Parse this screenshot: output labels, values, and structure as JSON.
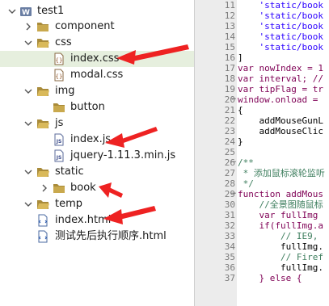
{
  "tree": {
    "root": {
      "label": "test1"
    },
    "component": {
      "label": "component"
    },
    "css": {
      "label": "css",
      "files": [
        {
          "label": "index.css"
        },
        {
          "label": "modal.css"
        }
      ]
    },
    "img": {
      "label": "img",
      "children": [
        {
          "label": "button"
        }
      ]
    },
    "js": {
      "label": "js",
      "files": [
        {
          "label": "index.js"
        },
        {
          "label": "jquery-1.11.3.min.js"
        }
      ]
    },
    "static": {
      "label": "static",
      "children": [
        {
          "label": "book"
        }
      ]
    },
    "temp": {
      "label": "temp"
    },
    "root_files": [
      {
        "label": "index.html"
      },
      {
        "label": "测试先后执行顺序.html"
      }
    ]
  },
  "editor": {
    "lines": [
      {
        "num": "11",
        "text": "    'static/book"
      },
      {
        "num": "12",
        "text": "    'static/book"
      },
      {
        "num": "13",
        "text": "    'static/book"
      },
      {
        "num": "14",
        "text": "    'static/book"
      },
      {
        "num": "15",
        "text": "    'static/book"
      },
      {
        "num": "16",
        "text": "]"
      },
      {
        "num": "17",
        "text": "var nowIndex = 1"
      },
      {
        "num": "18",
        "text": "var interval; //"
      },
      {
        "num": "19",
        "text": "var tipFlag = tr"
      },
      {
        "num": "20",
        "text": "window.onload = "
      },
      {
        "num": "21",
        "text": "{"
      },
      {
        "num": "22",
        "text": "    addMouseGunL"
      },
      {
        "num": "23",
        "text": "    addMouseClic"
      },
      {
        "num": "24",
        "text": "}"
      },
      {
        "num": "25",
        "text": ""
      },
      {
        "num": "26",
        "text": "/**"
      },
      {
        "num": "27",
        "text": " * 添加鼠标滚轮监听"
      },
      {
        "num": "28",
        "text": " */"
      },
      {
        "num": "29",
        "text": "function addMous"
      },
      {
        "num": "30",
        "text": "    //全景图随鼠标"
      },
      {
        "num": "31",
        "text": "    var fullImg "
      },
      {
        "num": "32",
        "text": "    if(fullImg.a"
      },
      {
        "num": "33",
        "text": "        // IE9, "
      },
      {
        "num": "34",
        "text": "        fullImg."
      },
      {
        "num": "35",
        "text": "        // Firef"
      },
      {
        "num": "36",
        "text": "        fullImg."
      },
      {
        "num": "37",
        "text": "    } else {"
      }
    ]
  },
  "colors": {
    "keyword": "#7f0055",
    "string": "#2a00ff",
    "comment": "#3f7f5f",
    "plain": "#000000",
    "arrow": "#ee2222",
    "selection": "#e6efde"
  }
}
